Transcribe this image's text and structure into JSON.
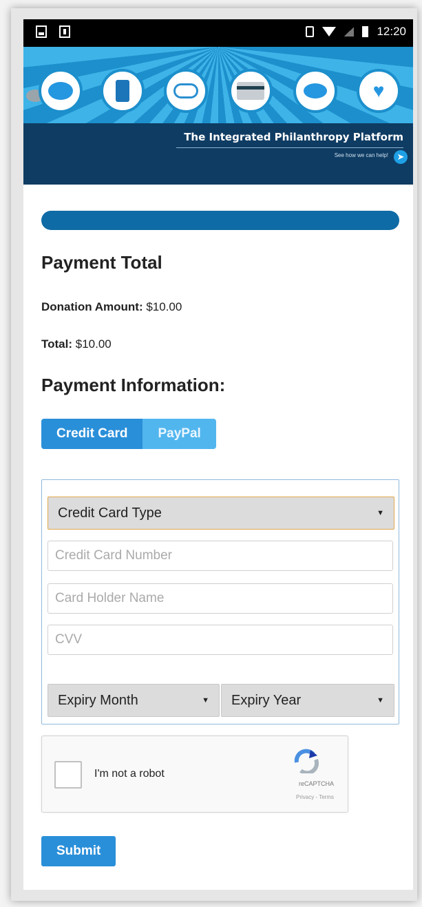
{
  "status_bar": {
    "time": "12:20"
  },
  "banner": {
    "title": "The Integrated Philanthropy Platform",
    "subtitle": "See how we can help!",
    "icons": [
      "chat-icon",
      "phone-dollar-icon",
      "cloud-link-icon",
      "credit-card-icon",
      "piggy-bank-icon",
      "heart-hand-icon"
    ]
  },
  "payment_total": {
    "heading": "Payment Total",
    "donation_label": "Donation Amount:",
    "donation_value": " $10.00",
    "total_label": "Total:",
    "total_value": " $10.00"
  },
  "payment_info": {
    "heading": "Payment Information:",
    "tabs": [
      {
        "label": "Credit Card",
        "active": true
      },
      {
        "label": "PayPal",
        "active": false
      }
    ]
  },
  "form": {
    "card_type": "Credit Card Type",
    "card_number_placeholder": "Credit Card Number",
    "card_holder_placeholder": "Card Holder Name",
    "cvv_placeholder": "CVV",
    "expiry_month": "Expiry Month",
    "expiry_year": "Expiry Year"
  },
  "captcha": {
    "label": "I'm not a robot",
    "brand": "reCAPTCHA",
    "links": "Privacy - Terms"
  },
  "submit_label": "Submit",
  "colors": {
    "accent": "#2a8fd9",
    "banner_dark": "#0f3c63",
    "progress": "#0f6ba5"
  }
}
